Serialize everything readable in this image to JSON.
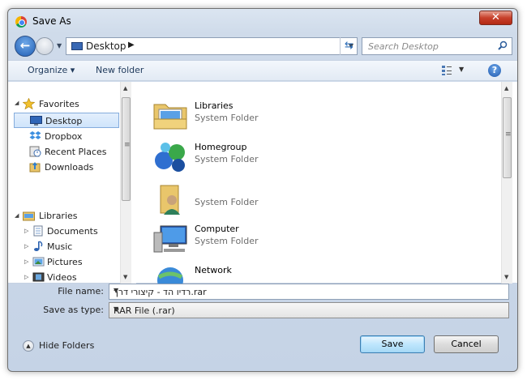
{
  "window": {
    "title": "Save As",
    "close_label": "✕"
  },
  "address_bar": {
    "location": "Desktop",
    "separator": "▶"
  },
  "search": {
    "placeholder": "Search Desktop"
  },
  "toolbar": {
    "organize_label": "Organize ▾",
    "new_folder_label": "New folder"
  },
  "nav": {
    "favorites_label": "Favorites",
    "favorites": [
      {
        "label": "Desktop",
        "icon": "desktop-icon"
      },
      {
        "label": "Dropbox",
        "icon": "dropbox-icon"
      },
      {
        "label": "Recent Places",
        "icon": "recent-places-icon"
      },
      {
        "label": "Downloads",
        "icon": "downloads-icon"
      }
    ],
    "libraries_label": "Libraries",
    "libraries": [
      {
        "label": "Documents",
        "icon": "documents-icon"
      },
      {
        "label": "Music",
        "icon": "music-icon"
      },
      {
        "label": "Pictures",
        "icon": "pictures-icon"
      },
      {
        "label": "Videos",
        "icon": "videos-icon"
      }
    ]
  },
  "files": [
    {
      "name": "Libraries",
      "type": "System Folder",
      "icon": "libraries-folder-icon"
    },
    {
      "name": "Homegroup",
      "type": "System Folder",
      "icon": "homegroup-icon"
    },
    {
      "name": "",
      "type": "System Folder",
      "icon": "user-folder-icon"
    },
    {
      "name": "Computer",
      "type": "System Folder",
      "icon": "computer-icon"
    },
    {
      "name": "Network",
      "type": "",
      "icon": "network-icon"
    }
  ],
  "form": {
    "file_name_label": "File name:",
    "file_name_value": "רדיו הד - קיצורי דרך.rar",
    "save_type_label": "Save as type:",
    "save_type_value": "RAR File (.rar)"
  },
  "footer": {
    "hide_folders_label": "Hide Folders",
    "save_label": "Save",
    "cancel_label": "Cancel"
  },
  "colors": {
    "accent": "#3c7fb1",
    "selection": "#cfe4fb",
    "close": "#c7402b"
  }
}
